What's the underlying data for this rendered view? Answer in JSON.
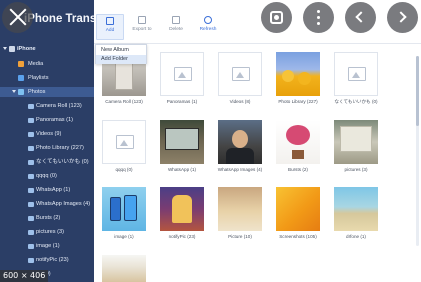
{
  "app": {
    "title": "iPhone Transfer"
  },
  "toolbar": {
    "add": "Add",
    "export": "Export to",
    "delete": "Delete",
    "refresh": "Refresh"
  },
  "dropdown": {
    "items": [
      "New Album",
      "Add Folder"
    ]
  },
  "sidebar": {
    "device": "iPhone",
    "media": "Media",
    "playlists": "Playlists",
    "photos": "Photos",
    "albums": [
      "Camera Roll (123)",
      "Panoramas (1)",
      "Videos (9)",
      "Photo Library (227)",
      "なくてもいいかも (0)",
      "qqqq (0)",
      "WhatsApp (1)",
      "WhatsApp Images (4)",
      "Bursts (2)",
      "pictures (3)",
      "image (1)",
      "notifyPic (23)",
      "e (10)"
    ]
  },
  "grid": {
    "items": [
      "Camera Roll (123)",
      "Panoramas (1)",
      "Videos (8)",
      "Photo Library (227)",
      "なくてもいいかも (0)",
      "qqqq (0)",
      "WhatsApp (1)",
      "WhatsApp Images (4)",
      "Bursts (2)",
      "pictures (3)",
      "image (1)",
      "notifyPic (23)",
      "Picture (10)",
      "Screenshots (105)",
      "drfone (1)"
    ]
  },
  "overlay": {
    "size_badge": "600 × 406"
  },
  "colors": {
    "sidebar_bg": "#2b3e66",
    "accent": "#3b6fd8",
    "selected_row": "#3d5b92"
  }
}
